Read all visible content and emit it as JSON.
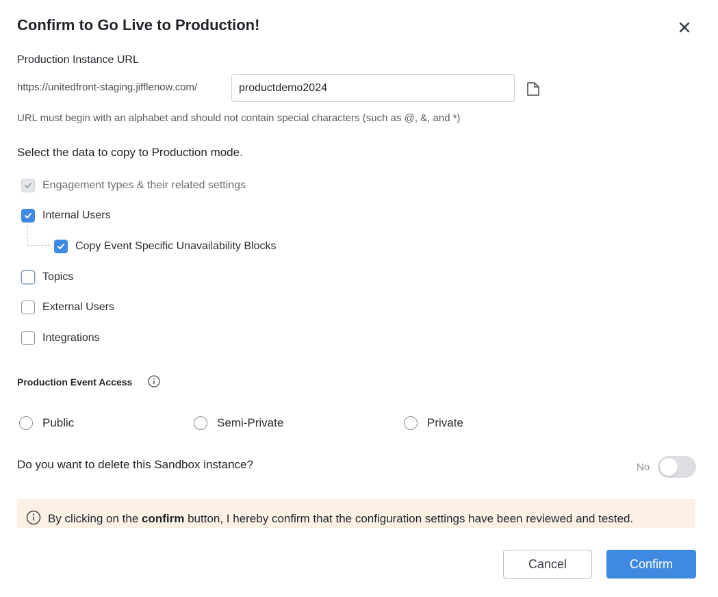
{
  "dialog": {
    "title": "Confirm to Go Live to Production!"
  },
  "url_section": {
    "label": "Production Instance URL",
    "prefix": "https://unitedfront-staging.jifflenow.com/",
    "value": "productdemo2024",
    "hint": "URL must begin with an alphabet and should not contain special characters (such as @, &, and *)"
  },
  "data_copy": {
    "label": "Select the data to copy to Production mode.",
    "options": [
      {
        "label": "Engagement types & their related settings",
        "checked": true,
        "disabled": true
      },
      {
        "label": "Internal Users",
        "checked": true,
        "disabled": false
      },
      {
        "label": "Copy Event Specific Unavailability Blocks",
        "checked": true,
        "disabled": false,
        "nested": true
      },
      {
        "label": "Topics",
        "checked": false,
        "disabled": false
      },
      {
        "label": "External Users",
        "checked": false,
        "disabled": false
      },
      {
        "label": "Integrations",
        "checked": false,
        "disabled": false
      }
    ]
  },
  "event_access": {
    "label": "Production Event Access",
    "options": [
      {
        "label": "Public",
        "selected": false
      },
      {
        "label": "Semi-Private",
        "selected": false
      },
      {
        "label": "Private",
        "selected": false
      }
    ]
  },
  "delete_sandbox": {
    "question": "Do you want to delete this Sandbox instance?",
    "toggle_label": "No",
    "enabled": false
  },
  "banner": {
    "prefix": "By clicking on the ",
    "emphasis": "confirm",
    "suffix": " button, I hereby confirm that the configuration settings have been reviewed and tested."
  },
  "buttons": {
    "cancel": "Cancel",
    "confirm": "Confirm"
  },
  "colors": {
    "accent": "#3f8ae0",
    "banner_bg": "#fdf1e6"
  },
  "icons": {
    "close": "close-icon",
    "copy": "copy-icon",
    "info": "info-icon",
    "check": "check-icon"
  }
}
